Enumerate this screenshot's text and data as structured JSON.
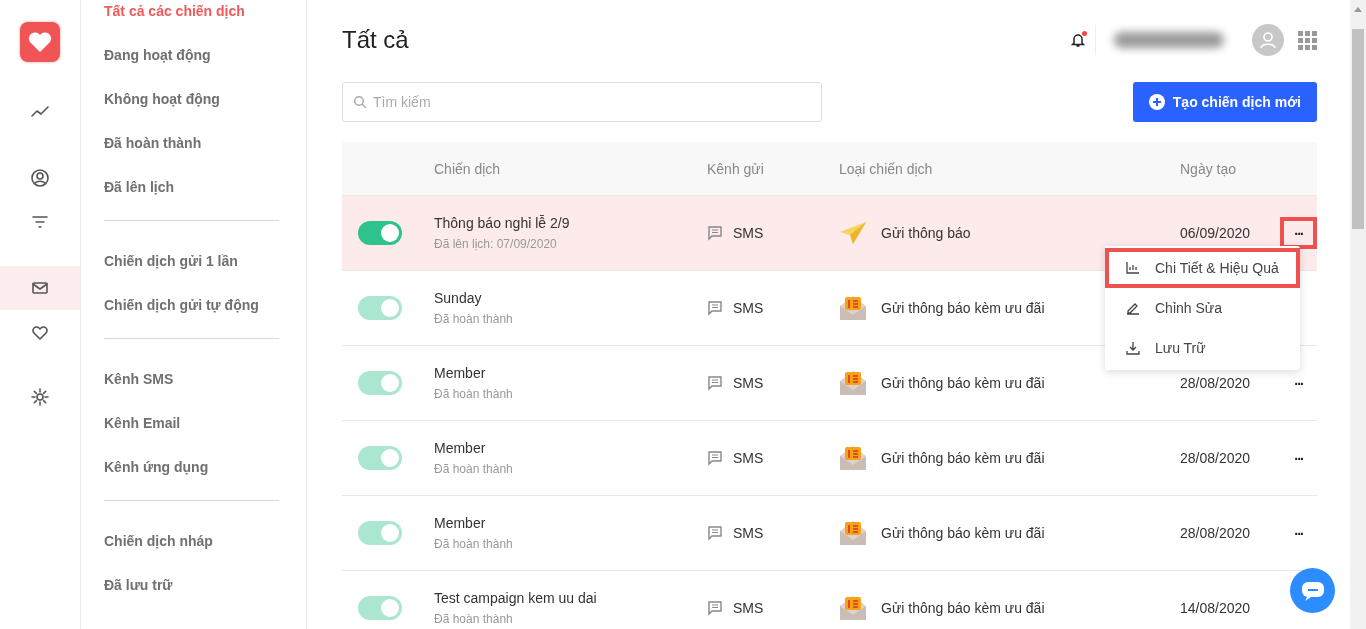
{
  "rail": {
    "items": [
      {
        "kind": "trend",
        "selected": false
      },
      {
        "kind": "user",
        "selected": false
      },
      {
        "kind": "filter",
        "selected": false
      },
      {
        "kind": "mail",
        "selected": true
      },
      {
        "kind": "heart",
        "selected": false
      },
      {
        "kind": "gear",
        "selected": false
      }
    ]
  },
  "subnav": {
    "groups": [
      [
        {
          "label": "Tất cả các chiến dịch",
          "selected": true
        },
        {
          "label": "Đang hoạt động",
          "selected": false
        },
        {
          "label": "Không hoạt động",
          "selected": false
        },
        {
          "label": "Đã hoàn thành",
          "selected": false
        },
        {
          "label": "Đã lên lịch",
          "selected": false
        }
      ],
      [
        {
          "label": "Chiến dịch gửi 1 lần",
          "selected": false
        },
        {
          "label": "Chiến dịch gửi tự động",
          "selected": false
        }
      ],
      [
        {
          "label": "Kênh SMS",
          "selected": false
        },
        {
          "label": "Kênh Email",
          "selected": false
        },
        {
          "label": "Kênh ứng dụng",
          "selected": false
        }
      ],
      [
        {
          "label": "Chiến dịch nháp",
          "selected": false
        },
        {
          "label": "Đã lưu trữ",
          "selected": false
        }
      ]
    ]
  },
  "header": {
    "title": "Tất cả",
    "notification_unread": true
  },
  "search": {
    "placeholder": "Tìm kiếm"
  },
  "create_button": "Tạo chiến dịch mới",
  "table": {
    "columns": [
      "Chiến dịch",
      "Kênh gửi",
      "Loại chiến dịch",
      "Ngày tạo"
    ],
    "rows": [
      {
        "kind": "notice",
        "on": true,
        "disabled": false,
        "selected": true,
        "name": "Thông báo nghỉ lễ 2/9",
        "status": "Đã lên lịch: 07/09/2020",
        "channel": "SMS",
        "type": "Gửi thông báo",
        "date": "06/09/2020",
        "more": "...",
        "annotated": true
      },
      {
        "kind": "offer",
        "on": true,
        "disabled": true,
        "selected": false,
        "name": "Sunday",
        "status": "Đã hoàn thành",
        "channel": "SMS",
        "type": "Gửi thông báo kèm ưu đãi"
      },
      {
        "kind": "offer",
        "on": true,
        "disabled": true,
        "selected": false,
        "name": "Member",
        "status": "Đã hoàn thành",
        "channel": "SMS",
        "type": "Gửi thông báo kèm ưu đãi",
        "date": "28/08/2020",
        "more": "...",
        "annotated": false
      },
      {
        "kind": "offer",
        "on": true,
        "disabled": true,
        "selected": false,
        "name": "Member",
        "status": "Đã hoàn thành",
        "channel": "SMS",
        "type": "Gửi thông báo kèm ưu đãi",
        "date": "28/08/2020",
        "more": "...",
        "annotated": false
      },
      {
        "kind": "offer",
        "on": true,
        "disabled": true,
        "selected": false,
        "name": "Member",
        "status": "Đã hoàn thành",
        "channel": "SMS",
        "type": "Gửi thông báo kèm ưu đãi",
        "date": "28/08/2020",
        "more": "...",
        "annotated": false
      },
      {
        "kind": "offer",
        "on": true,
        "disabled": true,
        "selected": false,
        "name": "Test campaign kem uu dai",
        "status": "Đã hoàn thành",
        "channel": "SMS",
        "type": "Gửi thông báo kèm ưu đãi",
        "date": "14/08/2020"
      }
    ]
  },
  "menu": {
    "items": [
      {
        "kind": "chart",
        "label": "Chi Tiết & Hiệu Quả",
        "annotated": true
      },
      {
        "kind": "edit",
        "label": "Chỉnh Sửa",
        "annotated": false
      },
      {
        "kind": "archive",
        "label": "Lưu Trữ",
        "annotated": false
      }
    ]
  }
}
